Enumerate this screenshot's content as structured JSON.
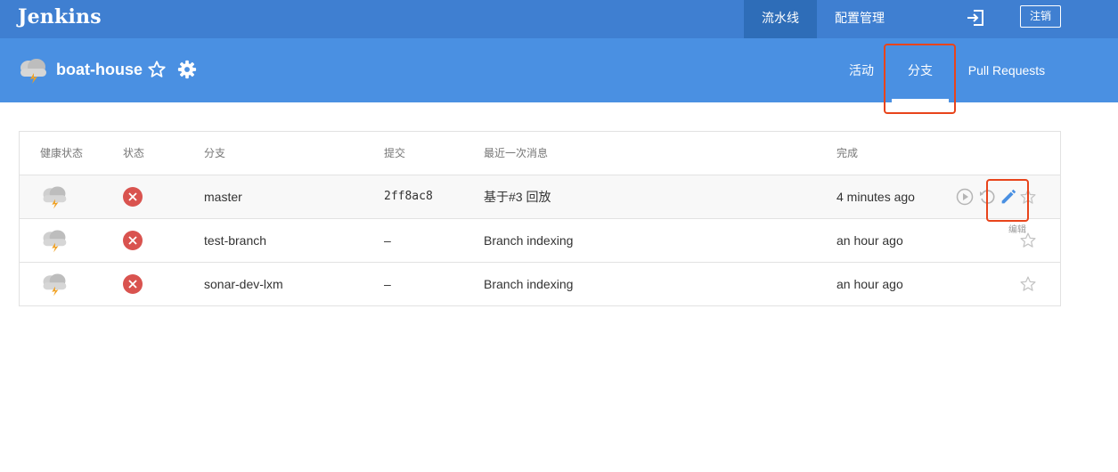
{
  "app": {
    "logo": "Jenkins"
  },
  "topnav": {
    "pipeline": "流水线",
    "admin": "配置管理",
    "logout": "注销"
  },
  "header": {
    "repo_name": "boat-house"
  },
  "tabs": {
    "activity": "活动",
    "branches": "分支",
    "pull_requests": "Pull Requests"
  },
  "table": {
    "columns": {
      "health": "健康状态",
      "status": "状态",
      "branch": "分支",
      "commit": "提交",
      "message": "最近一次消息",
      "completed": "完成"
    },
    "rows": [
      {
        "branch": "master",
        "commit": "2ff8ac8",
        "message": "基于#3 回放",
        "completed": "4 minutes ago"
      },
      {
        "branch": "test-branch",
        "commit": "–",
        "message": "Branch indexing",
        "completed": "an hour ago"
      },
      {
        "branch": "sonar-dev-lxm",
        "commit": "–",
        "message": "Branch indexing",
        "completed": "an hour ago"
      }
    ],
    "edit_tooltip": "编辑"
  },
  "icons": {
    "weather": "cloud-lightning-icon",
    "status": "failed-x-icon",
    "favorite": "star-icon",
    "settings": "gear-icon",
    "run": "play-icon",
    "replay": "replay-icon",
    "edit": "pencil-icon",
    "login": "login-icon"
  },
  "colors": {
    "topbar": "#3f7fd1",
    "header": "#4a90e2",
    "failed": "#d9534f",
    "highlight": "#e8441b",
    "edit": "#4a90e2"
  }
}
